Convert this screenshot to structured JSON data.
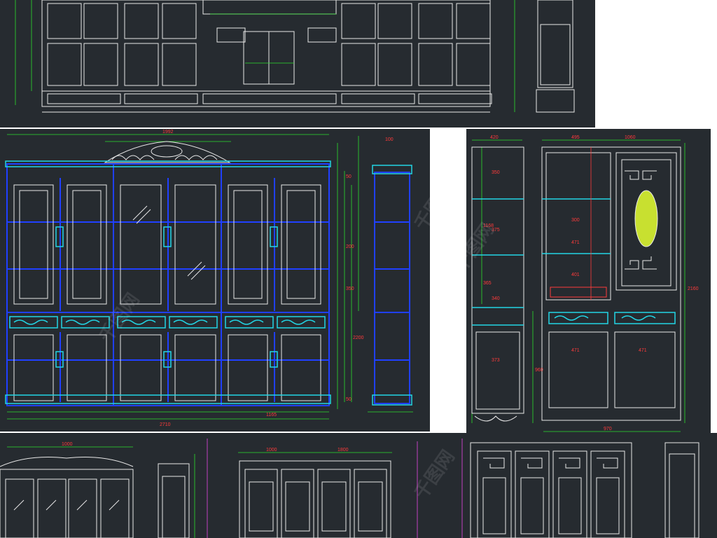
{
  "colors": {
    "background": "#262b30",
    "line_white": "#e8e8e8",
    "line_blue": "#2040ff",
    "line_cyan": "#22d6e6",
    "dim_green": "#2ee02e",
    "dim_red": "#ff3b3b",
    "carving_yellow": "#c8e030",
    "magenta": "#c040c0"
  },
  "left_drawing": {
    "dims_top": [
      "1992",
      "100"
    ],
    "dims_side": [
      "50",
      "200",
      "350",
      "2200",
      "50"
    ],
    "dims_bottom": [
      "2710",
      "1165"
    ]
  },
  "right_drawing": {
    "dims_top": [
      "420",
      "495",
      "1060"
    ],
    "dims_inner": [
      "350",
      "300",
      "375",
      "1168",
      "365",
      "471",
      "340",
      "401",
      "373",
      "471",
      "471",
      "970",
      "470",
      "960",
      "2160"
    ]
  },
  "bottom_drawing": {
    "dims": [
      "1000",
      "1000",
      "1800"
    ]
  },
  "watermark": {
    "text": "千图网"
  }
}
